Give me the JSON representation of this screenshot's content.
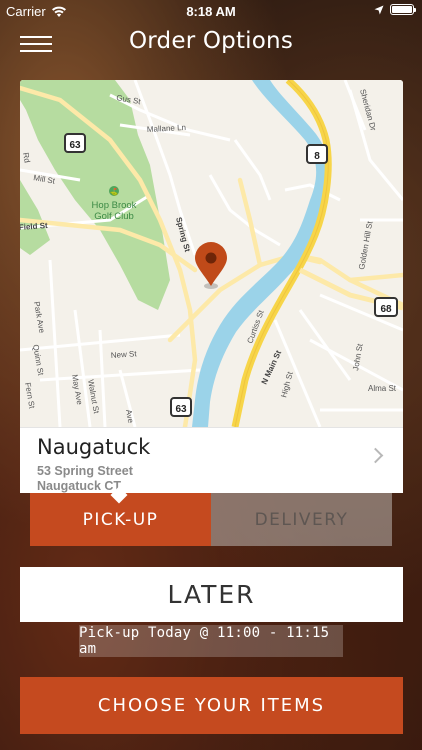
{
  "status": {
    "carrier": "Carrier",
    "time": "8:18 AM",
    "battery_level": 1.0
  },
  "nav": {
    "title": "Order Options",
    "menu_icon": "hamburger-menu-icon"
  },
  "map": {
    "streets": {
      "gus": "Gus St",
      "mallane": "Mallane Ln",
      "mill": "Mill St",
      "field": "Field St",
      "spring": "Spring St",
      "golden_hill": "Golden Hill St",
      "sheridan": "Sheridan Dr",
      "park": "Park Ave",
      "quinn": "Quinn St",
      "new": "New St",
      "may": "May Ave",
      "walnut": "Walnut St",
      "fern": "Fern St",
      "ave": "Ave",
      "curtiss": "Curtiss St",
      "n_main": "N Main St",
      "high": "High St",
      "john": "John St",
      "alma": "Alma St",
      "rd": "Rd"
    },
    "poi": {
      "golf_line1": "Hop Brook",
      "golf_line2": "Golf Club"
    },
    "shields": {
      "r63a": "63",
      "r8": "8",
      "r68": "68",
      "r63b": "63"
    },
    "colors": {
      "land": "#f4f1ea",
      "park": "#b6dca0",
      "water": "#9bd3e9",
      "highway": "#f7d548",
      "road": "#fde9a8",
      "pin": "#c04a19"
    }
  },
  "location": {
    "name": "Naugatuck",
    "street": "53 Spring Street",
    "city": "Naugatuck CT"
  },
  "order_type": {
    "pickup_label": "PICK-UP",
    "delivery_label": "DELIVERY",
    "selected": "pickup"
  },
  "timing": {
    "later_label": "LATER",
    "pickup_time": "Pick-up Today @ 11:00 - 11:15 am"
  },
  "actions": {
    "choose_label": "CHOOSE YOUR ITEMS"
  },
  "theme": {
    "accent": "#c54a1f"
  }
}
